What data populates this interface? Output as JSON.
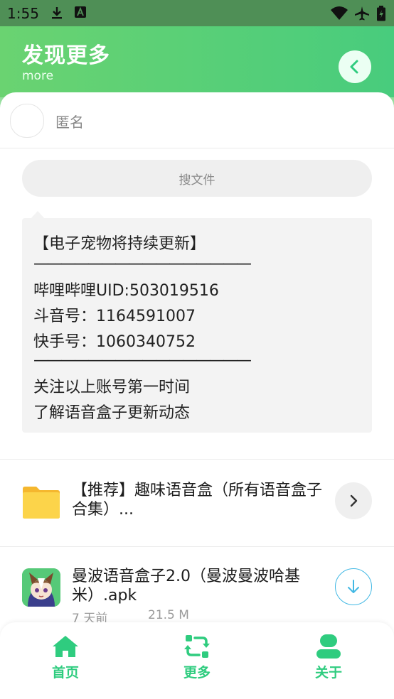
{
  "status_bar": {
    "time": "1:55",
    "icons": [
      "download-icon",
      "app-notification-icon",
      "wifi-icon",
      "airplane-mode-icon",
      "battery-icon"
    ]
  },
  "header": {
    "title": "发现更多",
    "subtitle": "more",
    "back_icon": "chevron-left-icon"
  },
  "user": {
    "name": "匿名"
  },
  "search": {
    "label": "搜文件"
  },
  "notice": {
    "lines": [
      "【电子宠物将持续更新】",
      "————————————————",
      "哔哩哔哩UID:503019516",
      "斗音号：1164591007",
      "快手号：1060340752",
      "————————————————",
      "关注以上账号第一时间",
      "了解语音盒子更新动态"
    ]
  },
  "items": [
    {
      "type": "folder",
      "icon": "folder-icon",
      "title": "【推荐】趣味语音盒（所有语音盒子合集）...",
      "action_icon": "chevron-right-icon"
    },
    {
      "type": "file",
      "icon": "app-icon",
      "title": "曼波语音盒子2.0（曼波曼波哈基米）.apk",
      "time": "7 天前",
      "size": "21.5 M",
      "action_icon": "download-icon"
    }
  ],
  "nav": {
    "items": [
      {
        "label": "首页",
        "icon": "home-icon"
      },
      {
        "label": "更多",
        "icon": "refresh-icon"
      },
      {
        "label": "关于",
        "icon": "user-icon"
      }
    ]
  },
  "colors": {
    "accent": "#2fcc7f",
    "header_start": "#6ad371",
    "header_end": "#48cc7d",
    "download_blue": "#41b8e4",
    "folder_yellow": "#fccd3a"
  }
}
